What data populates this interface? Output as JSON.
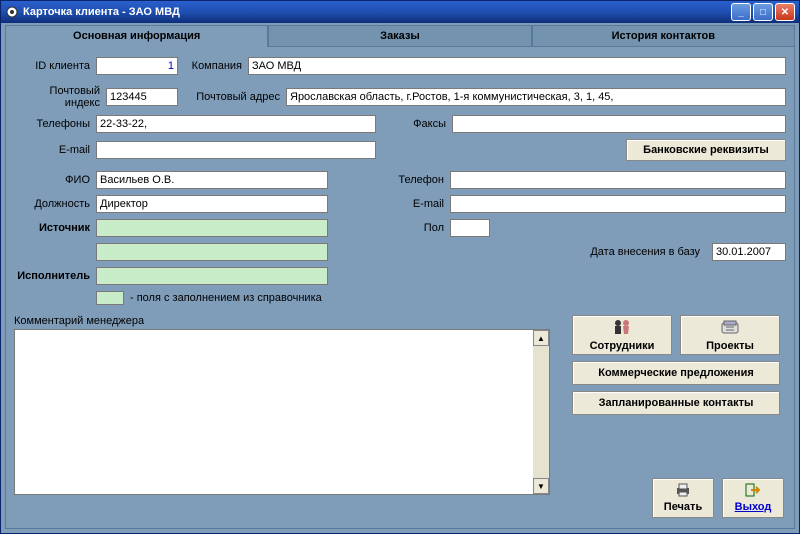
{
  "window": {
    "title": "Карточка клиента  -  ЗАО МВД"
  },
  "tabs": {
    "main": "Основная информация",
    "orders": "Заказы",
    "history": "История контактов"
  },
  "labels": {
    "client_id": "ID клиента",
    "company": "Компания",
    "postcode": "Почтовый индекс",
    "postaddr": "Почтовый адрес",
    "phones": "Телефоны",
    "faxes": "Факсы",
    "email": "E-mail",
    "fio": "ФИО",
    "position": "Должность",
    "source": "Источник",
    "executor": "Исполнитель",
    "phone": "Телефон",
    "email2": "E-mail",
    "gender": "Пол",
    "date_added": "Дата внесения в базу",
    "legend": "- поля с заполнением из справочника",
    "comment": "Комментарий менеджера"
  },
  "values": {
    "client_id": "1",
    "company": "ЗАО МВД",
    "postcode": "123445",
    "postaddr": "Ярославская область, г.Ростов, 1-я коммунистическая, 3, 1, 45,",
    "phones": "22-33-22,",
    "faxes": "",
    "email": "",
    "fio": "Васильев О.В.",
    "position": "Директор",
    "source": "",
    "executor": "",
    "phone": "",
    "email2": "",
    "gender": "",
    "date_added": "30.01.2007",
    "comment": ""
  },
  "buttons": {
    "bank": "Банковские реквизиты",
    "employees": "Сотрудники",
    "projects": "Проекты",
    "offers": "Коммерческие предложения",
    "planned": "Запланированные контакты",
    "print": "Печать",
    "exit": "Выход"
  }
}
